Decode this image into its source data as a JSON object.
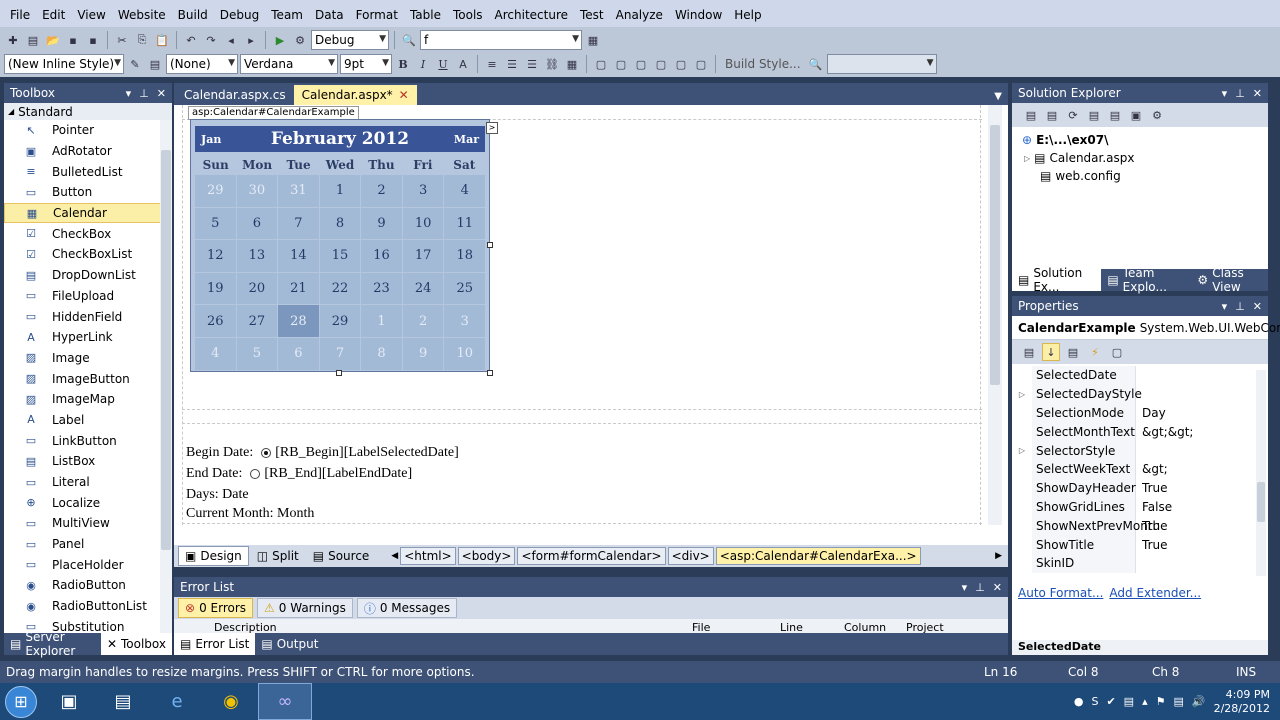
{
  "menu": [
    "File",
    "Edit",
    "View",
    "Website",
    "Build",
    "Debug",
    "Team",
    "Data",
    "Format",
    "Table",
    "Tools",
    "Architecture",
    "Test",
    "Analyze",
    "Window",
    "Help"
  ],
  "toolbar1": {
    "config": "Debug",
    "find": "f"
  },
  "toolbar2": {
    "style": "(New Inline Style)",
    "target": "(None)",
    "font": "Verdana",
    "size": "9pt",
    "bold": "B",
    "italic": "I",
    "underline": "U",
    "build_style": "Build Style..."
  },
  "toolbox": {
    "title": "Toolbox",
    "group": "Standard",
    "items": [
      "Pointer",
      "AdRotator",
      "BulletedList",
      "Button",
      "Calendar",
      "CheckBox",
      "CheckBoxList",
      "DropDownList",
      "FileUpload",
      "HiddenField",
      "HyperLink",
      "Image",
      "ImageButton",
      "ImageMap",
      "Label",
      "LinkButton",
      "ListBox",
      "Literal",
      "Localize",
      "MultiView",
      "Panel",
      "PlaceHolder",
      "RadioButton",
      "RadioButtonList",
      "Substitution"
    ],
    "icons": [
      "↖",
      "▣",
      "≡",
      "▭",
      "▦",
      "☑",
      "☑",
      "▤",
      "▭",
      "▭",
      "A",
      "▨",
      "▨",
      "▨",
      "A",
      "▭",
      "▤",
      "▭",
      "⊕",
      "▭",
      "▭",
      "▭",
      "◉",
      "◉",
      "▭"
    ],
    "selected_index": 4
  },
  "toolbox_tabs": {
    "server_explorer": "Server Explorer",
    "toolbox": "Toolbox"
  },
  "doc_tabs": {
    "tab1": "Calendar.aspx.cs",
    "tab2": "Calendar.aspx*"
  },
  "design": {
    "tag": "asp:Calendar#CalendarExample",
    "calendar": {
      "prev": "Jan",
      "title": "February 2012",
      "next": "Mar",
      "dow": [
        "Sun",
        "Mon",
        "Tue",
        "Wed",
        "Thu",
        "Fri",
        "Sat"
      ],
      "days": [
        "29",
        "30",
        "31",
        "1",
        "2",
        "3",
        "4",
        "5",
        "6",
        "7",
        "8",
        "9",
        "10",
        "11",
        "12",
        "13",
        "14",
        "15",
        "16",
        "17",
        "18",
        "19",
        "20",
        "21",
        "22",
        "23",
        "24",
        "25",
        "26",
        "27",
        "28",
        "29",
        "1",
        "2",
        "3",
        "4",
        "5",
        "6",
        "7",
        "8",
        "9",
        "10"
      ],
      "other_month_indices": [
        0,
        1,
        2,
        32,
        33,
        34,
        35,
        36,
        37,
        38,
        39,
        40,
        41
      ],
      "today_index": 30
    },
    "begin_label": "Begin Date:",
    "begin_text": "[RB_Begin][LabelSelectedDate]",
    "end_label": "End Date:",
    "end_text": "[RB_End][LabelEndDate]",
    "days_line": "Days: Date",
    "month_line": "Current Month: Month"
  },
  "viewbar": {
    "design": "Design",
    "split": "Split",
    "source": "Source",
    "crumbs": [
      "<html>",
      "<body>",
      "<form#formCalendar>",
      "<div>",
      "<asp:Calendar#CalendarExa...>"
    ]
  },
  "error_list": {
    "title": "Error List",
    "errors": "0 Errors",
    "warnings": "0 Warnings",
    "messages": "0 Messages",
    "columns": [
      "Description",
      "File",
      "Line",
      "Column",
      "Project"
    ],
    "tab_error": "Error List",
    "tab_output": "Output"
  },
  "solution_explorer": {
    "title": "Solution Explorer",
    "root": "E:\\...\\ex07\\",
    "files": [
      "Calendar.aspx",
      "web.config"
    ],
    "tabs": [
      "Solution Ex...",
      "Team Explo...",
      "Class View"
    ]
  },
  "properties": {
    "title": "Properties",
    "object": "CalendarExample",
    "object_type": "System.Web.UI.WebControls.C...",
    "rows": [
      {
        "name": "SelectedDate",
        "value": "",
        "exp": ""
      },
      {
        "name": "SelectedDayStyle",
        "value": "",
        "exp": "▷"
      },
      {
        "name": "SelectionMode",
        "value": "Day",
        "exp": ""
      },
      {
        "name": "SelectMonthText",
        "value": "&gt;&gt;",
        "exp": ""
      },
      {
        "name": "SelectorStyle",
        "value": "",
        "exp": "▷"
      },
      {
        "name": "SelectWeekText",
        "value": "&gt;",
        "exp": ""
      },
      {
        "name": "ShowDayHeader",
        "value": "True",
        "exp": ""
      },
      {
        "name": "ShowGridLines",
        "value": "False",
        "exp": ""
      },
      {
        "name": "ShowNextPrevMonth",
        "value": "True",
        "exp": ""
      },
      {
        "name": "ShowTitle",
        "value": "True",
        "exp": ""
      },
      {
        "name": "SkinID",
        "value": "",
        "exp": ""
      }
    ],
    "link1": "Auto Format...",
    "link2": "Add Extender...",
    "desc_title": "SelectedDate"
  },
  "status": {
    "message": "Drag margin handles to resize margins. Press SHIFT or CTRL for more options.",
    "ln": "Ln 16",
    "col": "Col 8",
    "ch": "Ch 8",
    "mode": "INS"
  },
  "taskbar": {
    "time": "4:09 PM",
    "date": "2/28/2012"
  },
  "colors": {
    "chrome_dark": "#3e5277",
    "calendar_header": "#3a5597",
    "calendar_cell": "#a3bad7",
    "selected": "#fbeea7"
  }
}
